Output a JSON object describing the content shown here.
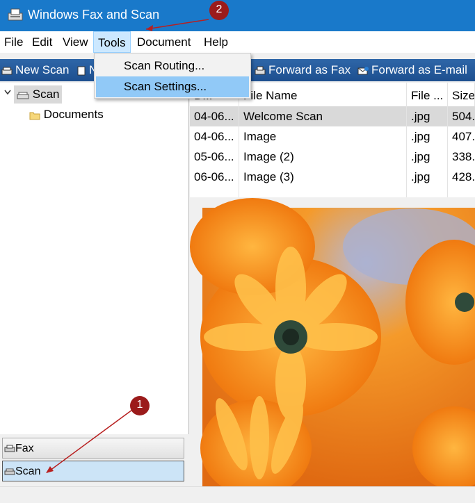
{
  "window": {
    "title": "Windows Fax and Scan"
  },
  "menu": {
    "file": "File",
    "edit": "Edit",
    "view": "View",
    "tools": "Tools",
    "document": "Document",
    "help": "Help"
  },
  "tools_menu": {
    "scan_routing": "Scan Routing...",
    "scan_settings": "Scan Settings..."
  },
  "toolbar": {
    "new_scan": "New Scan",
    "partial": "N",
    "forward_fax": "Forward as Fax",
    "forward_email": "Forward as E-mail"
  },
  "tree": {
    "root": "Scan",
    "child": "Documents"
  },
  "nav": {
    "fax": "Fax",
    "scan": "Scan"
  },
  "filelist": {
    "columns": {
      "date": "D...",
      "name": "File Name",
      "type": "File ...",
      "size": "Size"
    },
    "rows": [
      {
        "date": "04-06...",
        "name": "Welcome Scan",
        "type": ".jpg",
        "size": "504."
      },
      {
        "date": "04-06...",
        "name": "Image",
        "type": ".jpg",
        "size": "407."
      },
      {
        "date": "05-06...",
        "name": "Image (2)",
        "type": ".jpg",
        "size": "338."
      },
      {
        "date": "06-06...",
        "name": "Image (3)",
        "type": ".jpg",
        "size": "428."
      }
    ]
  },
  "annotations": {
    "one": "1",
    "two": "2"
  },
  "colors": {
    "titlebar": "#1979ca",
    "annotation": "#9b1b1b",
    "highlight": "#91c9f7"
  }
}
